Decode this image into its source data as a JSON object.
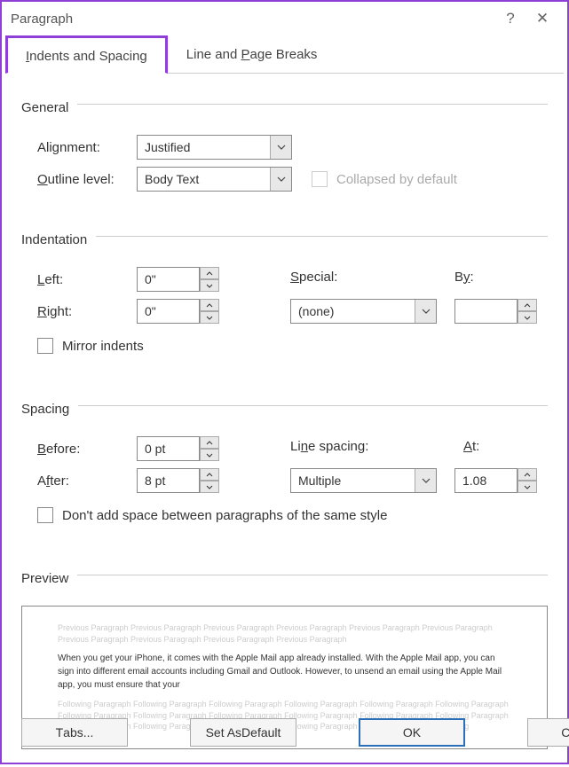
{
  "window": {
    "title": "Paragraph",
    "help": "?",
    "close": "✕"
  },
  "tabs": {
    "indents": "Indents and Spacing",
    "lineBreaks": "Line and Page Breaks"
  },
  "general": {
    "title": "General",
    "alignment_label": "Alignment:",
    "alignment_value": "Justified",
    "outline_label": "Outline level:",
    "outline_value": "Body Text",
    "collapsed_label": "Collapsed by default"
  },
  "indentation": {
    "title": "Indentation",
    "left_label": "Left:",
    "left_value": "0\"",
    "right_label": "Right:",
    "right_value": "0\"",
    "special_label": "Special:",
    "special_value": "(none)",
    "by_label": "By:",
    "by_value": "",
    "mirror_label": "Mirror indents"
  },
  "spacing": {
    "title": "Spacing",
    "before_label": "Before:",
    "before_value": "0 pt",
    "after_label": "After:",
    "after_value": "8 pt",
    "line_label": "Line spacing:",
    "line_value": "Multiple",
    "at_label": "At:",
    "at_value": "1.08",
    "dont_add_label": "Don't add space between paragraphs of the same style"
  },
  "preview": {
    "title": "Preview",
    "ghost_before": "Previous Paragraph Previous Paragraph Previous Paragraph Previous Paragraph Previous Paragraph Previous Paragraph Previous Paragraph Previous Paragraph Previous Paragraph Previous Paragraph",
    "sample": "When you get your iPhone, it comes with the Apple Mail app already installed. With the Apple Mail app, you can sign into different email accounts including Gmail and Outlook. However, to unsend an email using the Apple Mail app, you must ensure that your",
    "ghost_after": "Following Paragraph Following Paragraph Following Paragraph Following Paragraph Following Paragraph Following Paragraph Following Paragraph Following Paragraph Following Paragraph Following Paragraph Following Paragraph Following Paragraph Following Paragraph Following Paragraph Following Paragraph Following Paragraph Following Paragraph Following"
  },
  "buttons": {
    "tabs": "Tabs...",
    "default": "Set As Default",
    "ok": "OK",
    "cancel": "Cancel"
  }
}
